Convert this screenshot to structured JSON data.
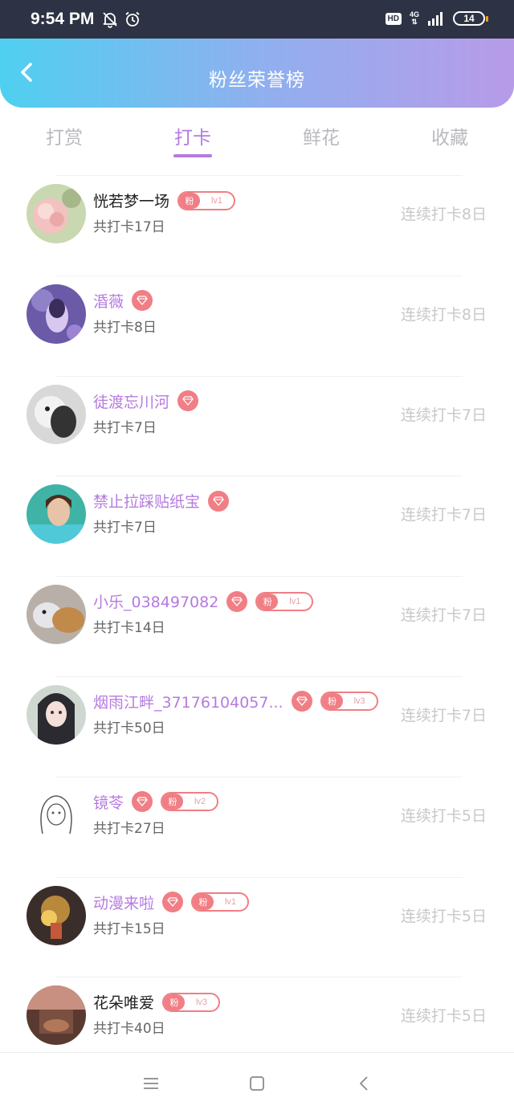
{
  "status_bar": {
    "time": "9:54 PM",
    "hd": "HD",
    "network": "4G",
    "battery": "14"
  },
  "header": {
    "title": "粉丝荣誉榜",
    "gradient_start": "#4fd0f0",
    "gradient_end": "#b79be8"
  },
  "tabs": [
    {
      "label": "打赏",
      "active": false
    },
    {
      "label": "打卡",
      "active": true
    },
    {
      "label": "鲜花",
      "active": false
    },
    {
      "label": "收藏",
      "active": false
    }
  ],
  "fans": [
    {
      "name": "恍若梦一场",
      "name_color": "dark",
      "diamond": false,
      "fan_label": "粉",
      "fan_level": "lv1",
      "total": "共打卡17日",
      "streak": "连续打卡8日",
      "avatar": "pink-flower"
    },
    {
      "name": "涽薇",
      "name_color": "purple",
      "diamond": true,
      "fan_label": "",
      "fan_level": "",
      "total": "共打卡8日",
      "streak": "连续打卡8日",
      "avatar": "purple-girl"
    },
    {
      "name": "徒渡忘川河",
      "name_color": "purple",
      "diamond": true,
      "fan_label": "",
      "fan_level": "",
      "total": "共打卡7日",
      "streak": "连续打卡7日",
      "avatar": "bw-cat"
    },
    {
      "name": "禁止拉踩贴纸宝",
      "name_color": "purple",
      "diamond": true,
      "fan_label": "",
      "fan_level": "",
      "total": "共打卡7日",
      "streak": "连续打卡7日",
      "avatar": "teal-girl"
    },
    {
      "name": "小乐_038497082",
      "name_color": "purple",
      "diamond": true,
      "fan_label": "粉",
      "fan_level": "lv1",
      "total": "共打卡14日",
      "streak": "连续打卡7日",
      "avatar": "cat-dog"
    },
    {
      "name": "烟雨江畔_37176104057...",
      "name_color": "purple",
      "diamond": true,
      "fan_label": "粉",
      "fan_level": "lv3",
      "total": "共打卡50日",
      "streak": "连续打卡7日",
      "avatar": "anime-girl"
    },
    {
      "name": "镜苓",
      "name_color": "purple",
      "diamond": true,
      "fan_label": "粉",
      "fan_level": "lv2",
      "total": "共打卡27日",
      "streak": "连续打卡5日",
      "avatar": "sketch-girl"
    },
    {
      "name": "动漫来啦",
      "name_color": "purple",
      "diamond": true,
      "fan_label": "粉",
      "fan_level": "lv1",
      "total": "共打卡15日",
      "streak": "连续打卡5日",
      "avatar": "golden-scene"
    },
    {
      "name": "花朵唯爱",
      "name_color": "dark",
      "diamond": false,
      "fan_label": "粉",
      "fan_level": "lv3",
      "total": "共打卡40日",
      "streak": "连续打卡5日",
      "avatar": "brown-scene"
    }
  ],
  "colors": {
    "accent": "#b57be0",
    "badge": "#f07e84",
    "muted": "#c8c8cc"
  }
}
